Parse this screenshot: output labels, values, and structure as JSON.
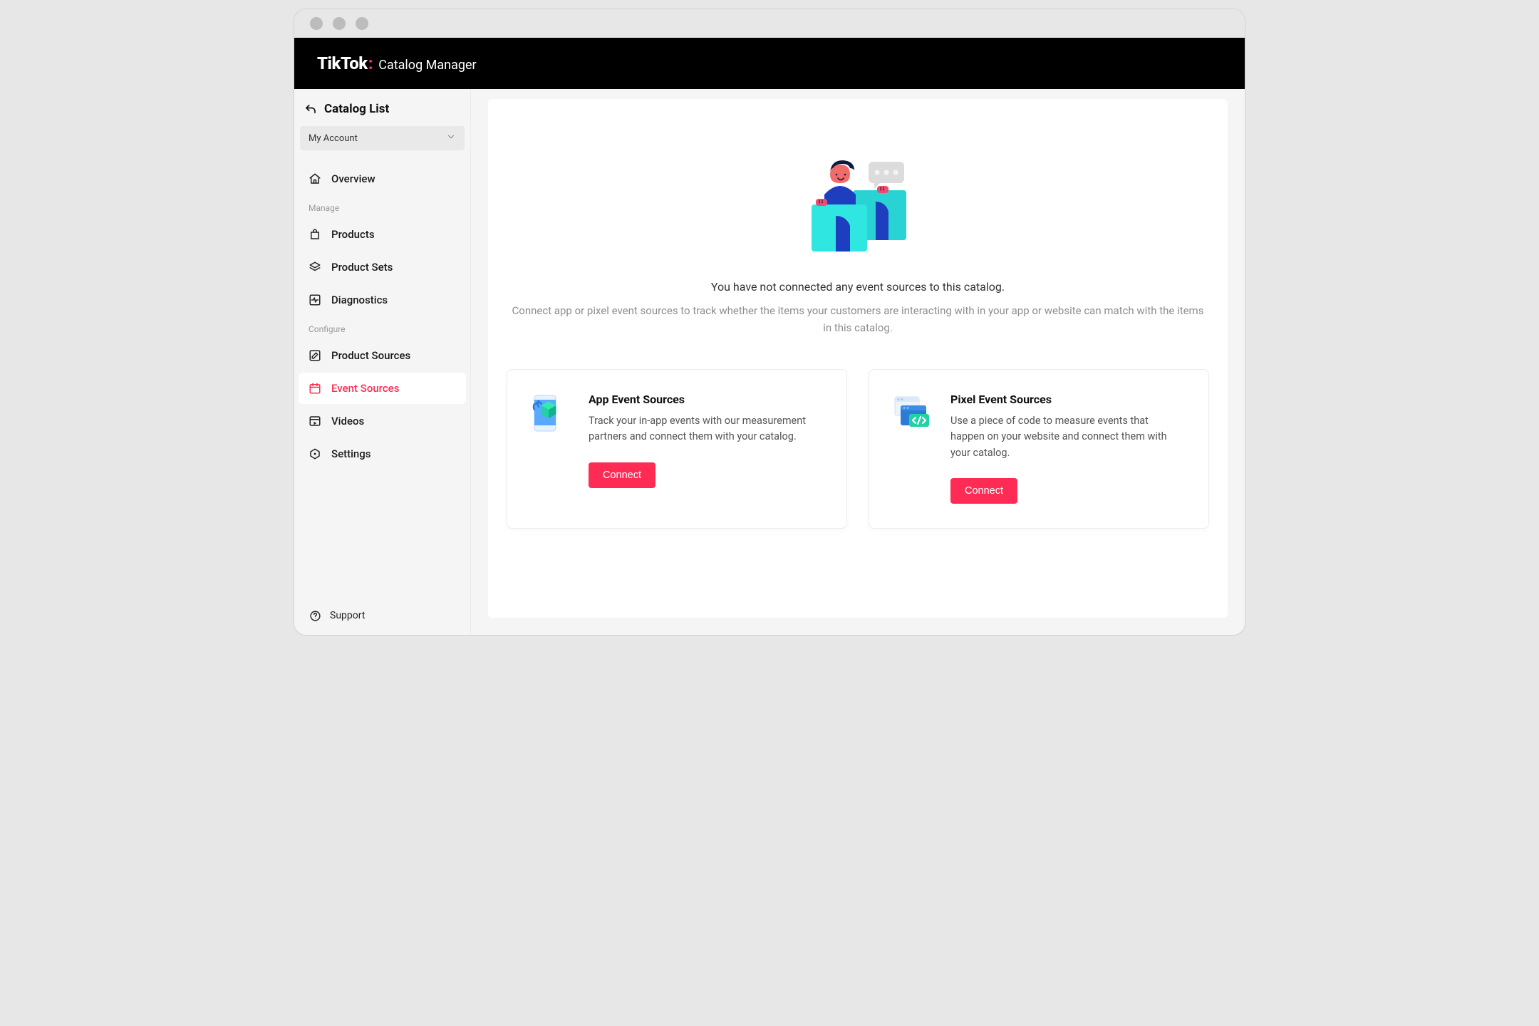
{
  "header": {
    "brand_name": "TikTok",
    "brand_sub": "Catalog Manager"
  },
  "sidebar": {
    "title": "Catalog List",
    "account_label": "My Account",
    "sections": {
      "manage_label": "Manage",
      "configure_label": "Configure"
    },
    "items": {
      "overview": "Overview",
      "products": "Products",
      "product_sets": "Product Sets",
      "diagnostics": "Diagnostics",
      "product_sources": "Product Sources",
      "event_sources": "Event Sources",
      "videos": "Videos",
      "settings": "Settings"
    },
    "support_label": "Support"
  },
  "main": {
    "empty_title": "You have not connected any event sources to this catalog.",
    "empty_desc": "Connect app or pixel event sources to track whether the items your customers are interacting with in your app or website can match with the items in this catalog.",
    "cards": {
      "app": {
        "title": "App Event Sources",
        "desc": "Track your in-app events with our measurement partners and connect them with your catalog.",
        "button": "Connect"
      },
      "pixel": {
        "title": "Pixel Event Sources",
        "desc": "Use a piece of code to measure events that happen on your website and connect them with your catalog.",
        "button": "Connect"
      }
    }
  }
}
